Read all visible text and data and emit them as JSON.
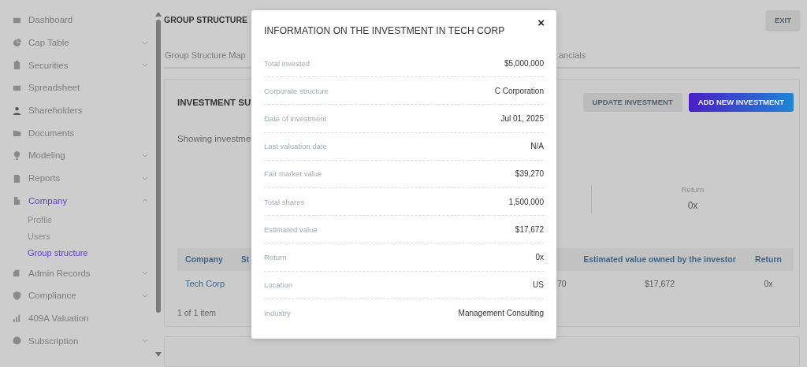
{
  "sidebar": {
    "items": [
      {
        "label": "Dashboard",
        "kind": "link",
        "selected": false
      },
      {
        "label": "Cap Table",
        "kind": "group",
        "expanded": false,
        "selected": false
      },
      {
        "label": "Securities",
        "kind": "group",
        "expanded": false,
        "selected": false
      },
      {
        "label": "Spreadsheet",
        "kind": "link",
        "selected": false
      },
      {
        "label": "Shareholders",
        "kind": "link",
        "selected": false
      },
      {
        "label": "Documents",
        "kind": "link",
        "selected": false
      },
      {
        "label": "Modeling",
        "kind": "group",
        "expanded": false,
        "selected": false
      },
      {
        "label": "Reports",
        "kind": "group",
        "expanded": false,
        "selected": false
      },
      {
        "label": "Company",
        "kind": "group",
        "expanded": true,
        "selected": true,
        "children": [
          {
            "label": "Profile",
            "selected": false
          },
          {
            "label": "Users",
            "selected": false
          },
          {
            "label": "Group structure",
            "selected": true
          }
        ]
      },
      {
        "label": "Admin Records",
        "kind": "group",
        "expanded": false,
        "selected": false
      },
      {
        "label": "Compliance",
        "kind": "group",
        "expanded": false,
        "selected": false
      },
      {
        "label": "409A Valuation",
        "kind": "link",
        "selected": false
      },
      {
        "label": "Subscription",
        "kind": "group",
        "expanded": false,
        "selected": false
      }
    ]
  },
  "page_title": "GROUP STRUCTURE",
  "exit_button": "EXIT",
  "tabs": [
    {
      "label": "Group Structure Map",
      "selected": false
    },
    {
      "label": "ancials",
      "selected": false
    }
  ],
  "investment_summary": {
    "title": "INVESTMENT SU",
    "buttons": [
      {
        "label": "UPDATE INVESTMENT",
        "kind": "secondary"
      },
      {
        "label": "ADD NEW INVESTMENT",
        "kind": "primary"
      }
    ],
    "note": "Showing investme",
    "stats": [
      {
        "label": "Return",
        "value": "0x"
      }
    ],
    "table": {
      "columns": {
        "company": "Company",
        "column_2": "St",
        "estimated_value": "Estimated value owned by the investor",
        "return": "Return"
      },
      "rows": [
        {
          "company": "Tech Corp",
          "column_4": "70",
          "estimated_value": "$17,672",
          "return": "0x"
        }
      ]
    },
    "pagination": "1 of 1 item"
  },
  "modal": {
    "title": "INFORMATION ON THE INVESTMENT IN TECH CORP",
    "close": "×",
    "rows": [
      {
        "label": "Total invested",
        "value": "$5,000,000"
      },
      {
        "label": "Corporate structure",
        "value": "C Corporation"
      },
      {
        "label": "Date of investment",
        "value": "Jul 01, 2025"
      },
      {
        "label": "Last valuation date",
        "value": "N/A"
      },
      {
        "label": "Fair market value",
        "value": "$39,270"
      },
      {
        "label": "Total shares",
        "value": "1,500,000"
      },
      {
        "label": "Estimated value",
        "value": "$17,672"
      },
      {
        "label": "Return",
        "value": "0x"
      },
      {
        "label": "Location",
        "value": "US"
      },
      {
        "label": "Industry",
        "value": "Management Consulting"
      }
    ]
  }
}
